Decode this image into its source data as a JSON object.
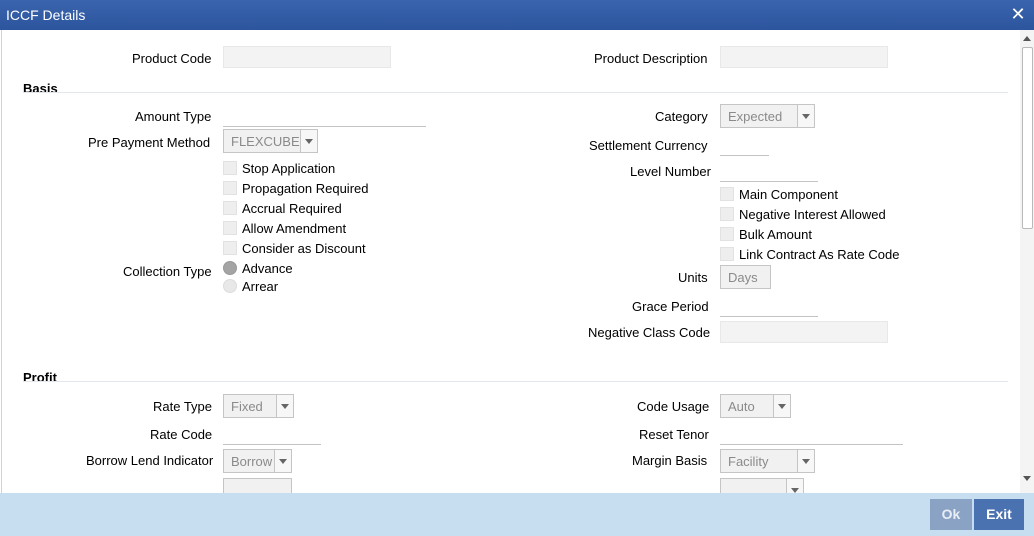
{
  "window": {
    "title": "ICCF Details",
    "close_symbol": "✕"
  },
  "header": {
    "product_code_label": "Product Code",
    "product_description_label": "Product Description"
  },
  "basis": {
    "section_title": "Basis",
    "amount_type_label": "Amount Type",
    "pre_payment_method_label": "Pre Payment Method",
    "pre_payment_method_value": "FLEXCUBE",
    "checkboxes_left": [
      "Stop Application",
      "Propagation Required",
      "Accrual Required",
      "Allow Amendment",
      "Consider as Discount"
    ],
    "collection_type_label": "Collection Type",
    "collection_type_options": [
      "Advance",
      "Arrear"
    ],
    "collection_type_selected": "Advance",
    "category_label": "Category",
    "category_value": "Expected",
    "settlement_currency_label": "Settlement Currency",
    "level_number_label": "Level Number",
    "checkboxes_right": [
      "Main Component",
      "Negative Interest Allowed",
      "Bulk Amount",
      "Link Contract As Rate Code"
    ],
    "units_label": "Units",
    "units_value": "Days",
    "grace_period_label": "Grace Period",
    "negative_class_code_label": "Negative Class Code"
  },
  "profit": {
    "section_title": "Profit",
    "rate_type_label": "Rate Type",
    "rate_type_value": "Fixed",
    "rate_code_label": "Rate Code",
    "borrow_lend_indicator_label": "Borrow Lend Indicator",
    "borrow_lend_indicator_value": "Borrow",
    "code_usage_label": "Code Usage",
    "code_usage_value": "Auto",
    "reset_tenor_label": "Reset Tenor",
    "margin_basis_label": "Margin Basis",
    "margin_basis_value": "Facility"
  },
  "footer": {
    "ok_label": "Ok",
    "exit_label": "Exit"
  }
}
